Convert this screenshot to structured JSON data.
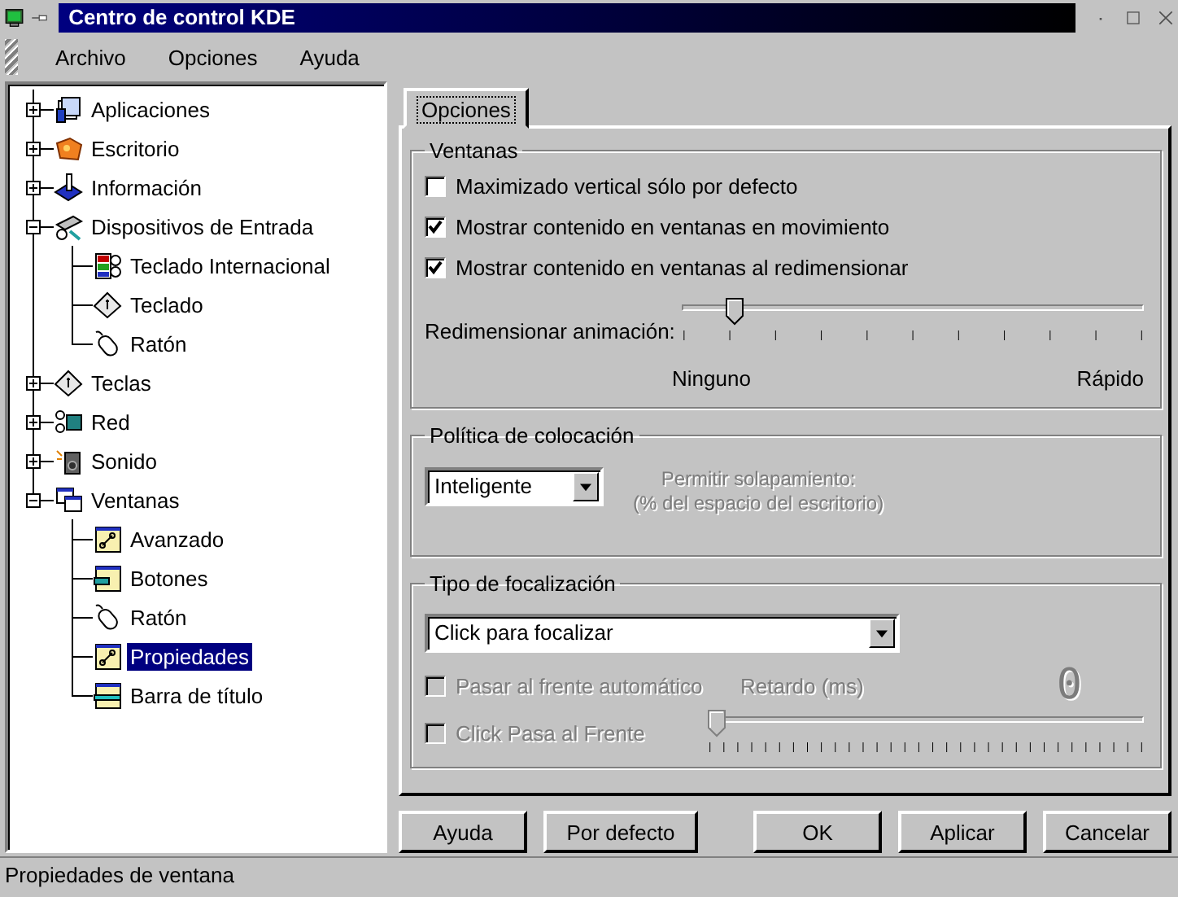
{
  "window": {
    "title": "Centro de control KDE"
  },
  "menu": [
    {
      "label": "Archivo"
    },
    {
      "label": "Opciones"
    },
    {
      "label": "Ayuda"
    }
  ],
  "tree": [
    {
      "label": "Aplicaciones",
      "kind": "applications",
      "expanded": false,
      "selected": false
    },
    {
      "label": "Escritorio",
      "kind": "desktop",
      "expanded": false,
      "selected": false
    },
    {
      "label": "Información",
      "kind": "information",
      "expanded": false,
      "selected": false
    },
    {
      "label": "Dispositivos de Entrada",
      "kind": "input-devices",
      "expanded": true,
      "selected": false,
      "children": [
        {
          "label": "Teclado Internacional",
          "kind": "keyboard-international",
          "selected": false
        },
        {
          "label": "Teclado",
          "kind": "keyboard",
          "selected": false
        },
        {
          "label": "Ratón",
          "kind": "mouse",
          "selected": false
        }
      ]
    },
    {
      "label": "Teclas",
      "kind": "keyboard",
      "expanded": false,
      "selected": false
    },
    {
      "label": "Red",
      "kind": "network",
      "expanded": false,
      "selected": false
    },
    {
      "label": "Sonido",
      "kind": "sound",
      "expanded": false,
      "selected": false
    },
    {
      "label": "Ventanas",
      "kind": "windows",
      "expanded": true,
      "selected": false,
      "children": [
        {
          "label": "Avanzado",
          "kind": "window-settings",
          "selected": false
        },
        {
          "label": "Botones",
          "kind": "window-buttons",
          "selected": false
        },
        {
          "label": "Ratón",
          "kind": "mouse",
          "selected": false
        },
        {
          "label": "Propiedades",
          "kind": "window-settings",
          "selected": true
        },
        {
          "label": "Barra de título",
          "kind": "window-titlebar",
          "selected": false
        }
      ]
    }
  ],
  "tabs": [
    {
      "label": "Opciones",
      "selected": true
    }
  ],
  "windows_group": {
    "title": "Ventanas",
    "options": [
      {
        "label": "Maximizado vertical sólo por defecto",
        "checked": false,
        "disabled": false
      },
      {
        "label": "Mostrar contenido en ventanas en movimiento",
        "checked": true,
        "disabled": false
      },
      {
        "label": "Mostrar contenido en ventanas al redimensionar",
        "checked": true,
        "disabled": false
      }
    ],
    "animation": {
      "label": "Redimensionar animación:",
      "level": 0.1,
      "min_label": "Ninguno",
      "max_label": "Rápido",
      "disabled": false
    }
  },
  "placement_group": {
    "title": "Política de colocación",
    "policy": {
      "value": "Inteligente"
    },
    "overlap_label": "Permitir solapamiento:",
    "overlap_sublabel": "(% del espacio del escritorio)",
    "overlap_disabled": true
  },
  "focus_group": {
    "title": "Tipo de focalización",
    "policy": {
      "value": "Click para focalizar"
    },
    "options": [
      {
        "label": "Pasar al frente automático",
        "checked": false,
        "disabled": true
      },
      {
        "label": "Click Pasa al Frente",
        "checked": false,
        "disabled": true
      }
    ],
    "delay": {
      "label": "Retardo (ms)",
      "display": "0",
      "level": 0,
      "disabled": true
    }
  },
  "buttons": [
    {
      "label": "Ayuda"
    },
    {
      "label": "Por defecto"
    },
    {
      "label": "OK"
    },
    {
      "label": "Aplicar"
    },
    {
      "label": "Cancelar"
    }
  ],
  "status_bar": "Propiedades de ventana"
}
